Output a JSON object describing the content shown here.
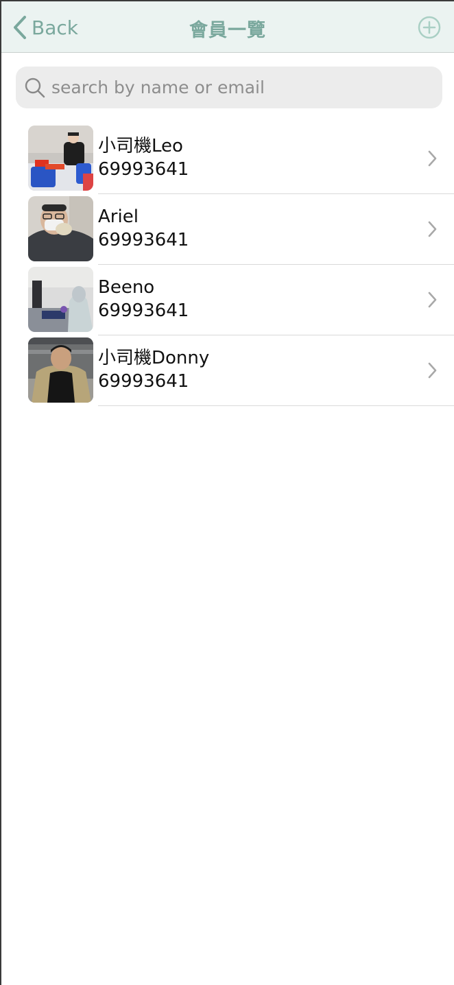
{
  "navbar": {
    "back_label": "Back",
    "title": "會員一覽",
    "back_icon": "chevron-left-icon",
    "add_icon": "plus-circle-icon",
    "accent_color": "#7aa89d"
  },
  "search": {
    "placeholder": "search by name or email",
    "value": "",
    "icon": "search-icon"
  },
  "members": [
    {
      "name": "小司機Leo",
      "phone": "69993641"
    },
    {
      "name": "Ariel",
      "phone": "69993641"
    },
    {
      "name": "Beeno",
      "phone": "69993641"
    },
    {
      "name": "小司機Donny",
      "phone": "69993641"
    }
  ]
}
